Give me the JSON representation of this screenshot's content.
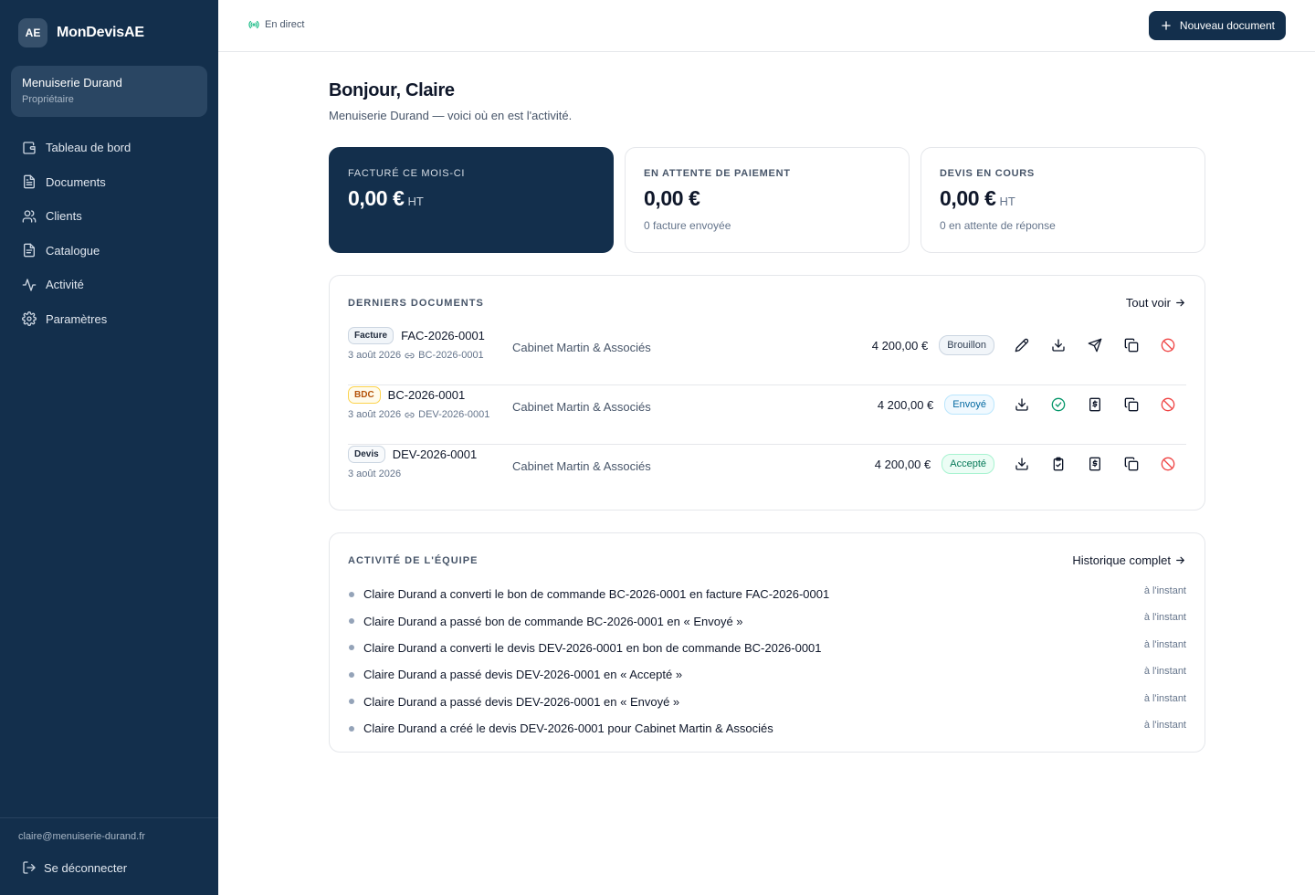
{
  "app": {
    "logo_initials": "AE",
    "name": "MonDevisAE"
  },
  "org": {
    "name": "Menuiserie Durand",
    "role": "Propriétaire"
  },
  "nav": [
    {
      "label": "Tableau de bord",
      "icon": "wallet-icon"
    },
    {
      "label": "Documents",
      "icon": "document-icon"
    },
    {
      "label": "Clients",
      "icon": "users-icon"
    },
    {
      "label": "Catalogue",
      "icon": "catalog-icon"
    },
    {
      "label": "Activité",
      "icon": "activity-icon"
    },
    {
      "label": "Paramètres",
      "icon": "gear-icon"
    }
  ],
  "user": {
    "email": "claire@menuiserie-durand.fr",
    "logout_label": "Se déconnecter"
  },
  "topbar": {
    "live_label": "En direct",
    "new_document_label": "Nouveau document"
  },
  "greeting": {
    "title": "Bonjour, Claire",
    "subtitle": "Menuiserie Durand — voici où en est l'activité."
  },
  "stats": [
    {
      "label": "Facturé ce mois-ci",
      "value": "0,00 €",
      "unit": "HT",
      "sub": ""
    },
    {
      "label": "En attente de paiement",
      "value": "0,00 €",
      "unit": "",
      "sub": "0 facture envoyée"
    },
    {
      "label": "Devis en cours",
      "value": "0,00 €",
      "unit": "HT",
      "sub": "0 en attente de réponse"
    }
  ],
  "documents": {
    "title": "Derniers documents",
    "link_label": "Tout voir",
    "rows": [
      {
        "type": "Facture",
        "number": "FAC-2026-0001",
        "date": "3 août 2026",
        "linked": "BC-2026-0001",
        "client": "Cabinet Martin & Associés",
        "amount": "4 200,00 €",
        "status": "Brouillon",
        "actions": [
          "pencil-icon",
          "download-icon",
          "send-icon",
          "copy-icon",
          "cancel-icon"
        ]
      },
      {
        "type": "BDC",
        "number": "BC-2026-0001",
        "date": "3 août 2026",
        "linked": "DEV-2026-0001",
        "client": "Cabinet Martin & Associés",
        "amount": "4 200,00 €",
        "status": "Envoyé",
        "actions": [
          "download-icon",
          "check-circle-icon",
          "invoice-icon",
          "copy-icon",
          "cancel-icon"
        ]
      },
      {
        "type": "Devis",
        "number": "DEV-2026-0001",
        "date": "3 août 2026",
        "linked": "",
        "client": "Cabinet Martin & Associés",
        "amount": "4 200,00 €",
        "status": "Accepté",
        "actions": [
          "download-icon",
          "clipboard-check-icon",
          "invoice-icon",
          "copy-icon",
          "cancel-icon"
        ]
      }
    ]
  },
  "activity": {
    "title": "Activité de l'équipe",
    "link_label": "Historique complet",
    "items": [
      {
        "text": "Claire Durand a converti le bon de commande BC-2026-0001 en facture FAC-2026-0001",
        "time": "à l'instant"
      },
      {
        "text": "Claire Durand a passé bon de commande BC-2026-0001 en « Envoyé »",
        "time": "à l'instant"
      },
      {
        "text": "Claire Durand a converti le devis DEV-2026-0001 en bon de commande BC-2026-0001",
        "time": "à l'instant"
      },
      {
        "text": "Claire Durand a passé devis DEV-2026-0001 en « Accepté »",
        "time": "à l'instant"
      },
      {
        "text": "Claire Durand a passé devis DEV-2026-0001 en « Envoyé »",
        "time": "à l'instant"
      },
      {
        "text": "Claire Durand a créé le devis DEV-2026-0001 pour Cabinet Martin & Associés",
        "time": "à l'instant"
      }
    ]
  },
  "colors": {
    "sidebar": "#132f4c",
    "accent": "#132f4c",
    "live": "#10b981",
    "danger": "#ef4444",
    "success": "#059669"
  }
}
